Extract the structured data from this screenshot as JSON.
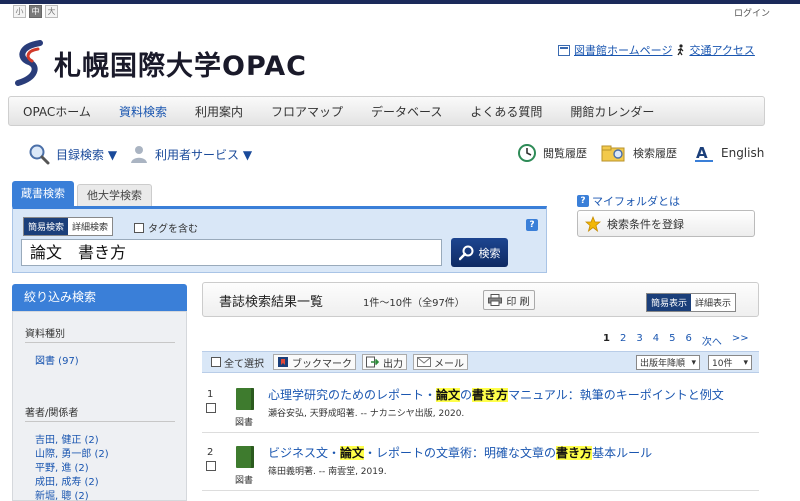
{
  "font_size": {
    "small": "小",
    "medium": "中",
    "large": "大"
  },
  "login": "ログイン",
  "site": {
    "title": "札幌国際大学OPAC"
  },
  "header_links": {
    "library_home": "図書館ホームページ",
    "access": "交通アクセス"
  },
  "nav": [
    {
      "label": "OPACホーム"
    },
    {
      "label": "資料検索"
    },
    {
      "label": "利用案内"
    },
    {
      "label": "フロアマップ"
    },
    {
      "label": "データベース"
    },
    {
      "label": "よくある質問"
    },
    {
      "label": "開館カレンダー"
    }
  ],
  "tools": {
    "catalog_search": "目録検索 ▼",
    "user_service": "利用者サービス ▼",
    "browse_history": "閲覧履歴",
    "search_history": "検索履歴",
    "english": "English"
  },
  "search": {
    "tab_active": "蔵書検索",
    "tab_other": "他大学検索",
    "mode_simple": "簡易検索",
    "mode_detail": "詳細検索",
    "include_tags": "タグを含む",
    "query": "論文　書き方",
    "button": "検索",
    "help": "?"
  },
  "myfolder": {
    "link": "マイフォルダとは",
    "save": "検索条件を登録"
  },
  "sidebar": {
    "title": "絞り込み検索",
    "material_type": {
      "heading": "資料種別",
      "items": [
        {
          "label": "図書 (97)"
        }
      ]
    },
    "authors": {
      "heading": "著者/関係者",
      "items": [
        {
          "label": "吉田, 健正 (2)"
        },
        {
          "label": "山際, 勇一郎 (2)"
        },
        {
          "label": "平野, 進 (2)"
        },
        {
          "label": "成田, 成寿 (2)"
        },
        {
          "label": "新堀, 聰 (2)"
        }
      ]
    }
  },
  "results": {
    "title": "書誌検索結果一覧",
    "count": "1件〜10件（全97件）",
    "print": "印 刷",
    "view_simple": "簡易表示",
    "view_detail": "詳細表示",
    "pages": [
      "1",
      "2",
      "3",
      "4",
      "5",
      "6",
      "次へ",
      ">>"
    ],
    "actions": {
      "select_all": "全て選択",
      "bookmark": "ブックマーク",
      "output": "出力",
      "mail": "メール"
    },
    "sort": "出版年降順",
    "per_page": "10件",
    "records": [
      {
        "num": "1",
        "type": "図書",
        "title_pre": "心理学研究のためのレポート・",
        "hl1": "論文",
        "title_mid": "の",
        "hl2": "書き方",
        "title_post": "マニュアル：執筆のキーポイントと例文",
        "sub": "瀬谷安弘, 天野成昭著. -- ナカニシヤ出版, 2020."
      },
      {
        "num": "2",
        "type": "図書",
        "title_pre": "ビジネス文・",
        "hl1": "論文",
        "title_mid": "・レポートの文章術：明確な文章の",
        "hl2": "書き方",
        "title_post": "基本ルール",
        "sub": "篠田義明著. -- 南雲堂, 2019."
      }
    ]
  },
  "colors": {
    "accent": "#3a7fd8",
    "dark_navy": "#1b3f7a",
    "link": "#1a56b0",
    "highlight": "#ffff4a"
  }
}
